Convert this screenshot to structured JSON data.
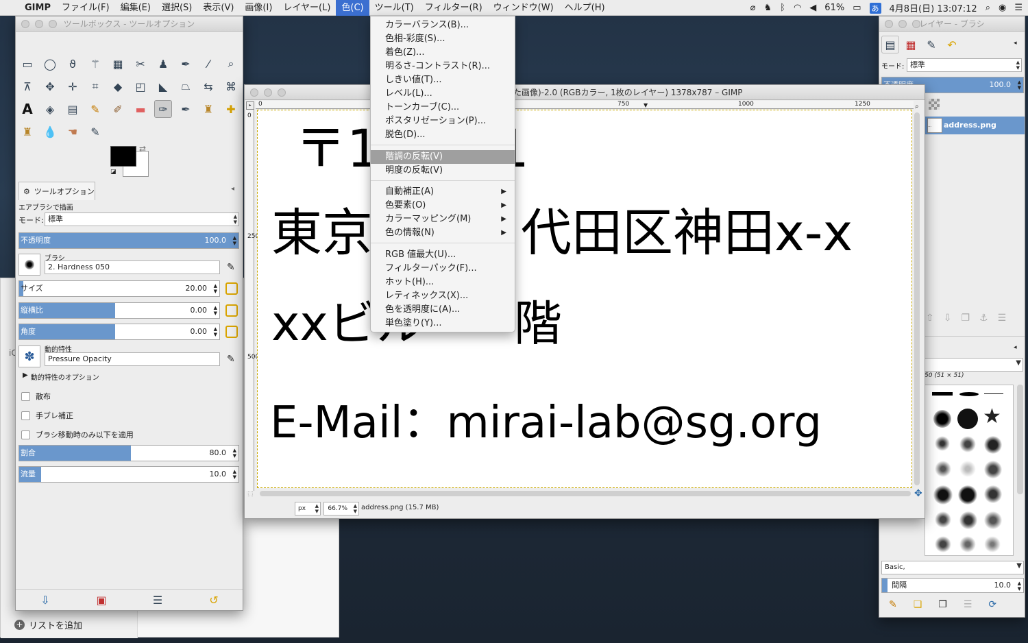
{
  "menubar": {
    "apple": "",
    "app": "GIMP",
    "items": [
      "ファイル(F)",
      "編集(E)",
      "選択(S)",
      "表示(V)",
      "画像(I)",
      "レイヤー(L)",
      "色(C)",
      "ツール(T)",
      "フィルター(R)",
      "ウィンドウ(W)",
      "ヘルプ(H)"
    ],
    "battery": "61%",
    "ime": "あ",
    "clock": "4月8日(日)  13:07:12"
  },
  "toolbox": {
    "title": "ツールボックス - ツールオプション",
    "tab": "ツールオプション",
    "tool_name": "エアブラシで描画",
    "mode_label": "モード:",
    "mode_value": "標準",
    "opacity_label": "不透明度",
    "opacity_value": "100.0",
    "brush_label": "ブラシ",
    "brush_value": "2. Hardness 050",
    "size_label": "サイズ",
    "size_value": "20.00",
    "aspect_label": "縦横比",
    "aspect_value": "0.00",
    "angle_label": "角度",
    "angle_value": "0.00",
    "dynamics_label": "動的特性",
    "dynamics_value": "Pressure Opacity",
    "dynamics_options": "動的特性のオプション",
    "scatter": "散布",
    "smooth": "手ブレ補正",
    "apply_jitter": "ブラシ移動時のみ以下を適用",
    "rate_label": "割合",
    "rate_value": "80.0",
    "flow_label": "流量",
    "flow_value": "10.0"
  },
  "colorsmenu": {
    "items": [
      "カラーバランス(B)...",
      "色相-彩度(S)...",
      "着色(Z)...",
      "明るさ-コントラスト(R)...",
      "しきい値(T)...",
      "レベル(L)...",
      "トーンカーブ(C)...",
      "ポスタリゼーション(P)...",
      "脱色(D)...",
      "階調の反転(V)",
      "明度の反転(V)",
      "自動補正(A)",
      "色要素(O)",
      "カラーマッピング(M)",
      "色の情報(N)",
      "RGB 値最大(U)...",
      "フィルターパック(F)...",
      "ホット(H)...",
      "レティネックス(X)...",
      "色を透明度に(A)...",
      "単色塗り(Y)..."
    ]
  },
  "image": {
    "title": "た画像)-2.0 (RGBカラー, 1枚のレイヤー) 1378x787 – GIMP",
    "ruler": [
      "0",
      "750",
      "1000",
      "1250"
    ],
    "vruler": [
      "0",
      "250",
      "500"
    ],
    "line1": "〒1    0021",
    "line2a": "東京",
    "line2b": "代田区神田x-x",
    "line3a": "xxビル",
    "line3b": "階",
    "line4": "E-Mail：mirai-lab@sg.org",
    "unit": "px",
    "zoom": "66.7%",
    "status": "address.png (15.7 MB)"
  },
  "layers": {
    "title": "レイヤー - ブラシ",
    "mode_label": "モード:",
    "mode_value": "標準",
    "opacity_label": "不透明度",
    "opacity_value": "100.0",
    "layer_name": "address.png",
    "brush_info": "50 (51 × 51)",
    "brush_tag": "Basic,",
    "spacing_label": "間隔",
    "spacing_value": "10.0"
  },
  "bgwindow": {
    "add_list": "リストを追加",
    "side_text": "iC"
  }
}
